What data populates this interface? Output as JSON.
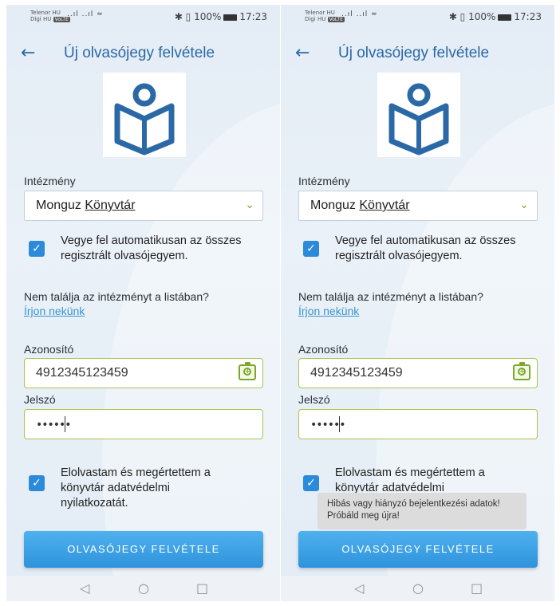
{
  "status": {
    "carrier1": "Telenor HU",
    "carrier2": "Digi HU",
    "volte": "VoLTE",
    "signal": "..ıl ..ıl ≈",
    "right": "✱ ▯ 100%",
    "time": "17:23"
  },
  "header": {
    "back": "←",
    "title": "Új olvasójegy felvétele"
  },
  "form": {
    "institution_label": "Intézmény",
    "institution_value_a": "Monguz ",
    "institution_value_b": "Könyvtár",
    "chevron": "⌄",
    "auto_check_text": "Vegye fel automatikusan az összes regisztrált olvasójegyem.",
    "not_found_text": "Nem találja az intézményt a listában?",
    "write_us_link": "Írjon nekünk",
    "id_label": "Azonosító",
    "id_value": "4912345123459",
    "password_label": "Jelszó",
    "password_value": "••••••",
    "privacy_text": "Elolvastam és megértettem a könyvtár adatvédelmi nyilatkozatát.",
    "submit_label": "OLVASÓJEGY FELVÉTELE",
    "checkmark": "✓"
  },
  "toast": {
    "message": "Hibás vagy hiányzó bejelentkezési adatok! Próbáld meg újra!"
  },
  "nav": {
    "back": "◁",
    "home": "○",
    "recents": "□"
  },
  "colors": {
    "accent": "#2b69a6",
    "button": "#3aa0e5",
    "field_border": "#a8c64a",
    "checkbox": "#2b8ad9"
  }
}
